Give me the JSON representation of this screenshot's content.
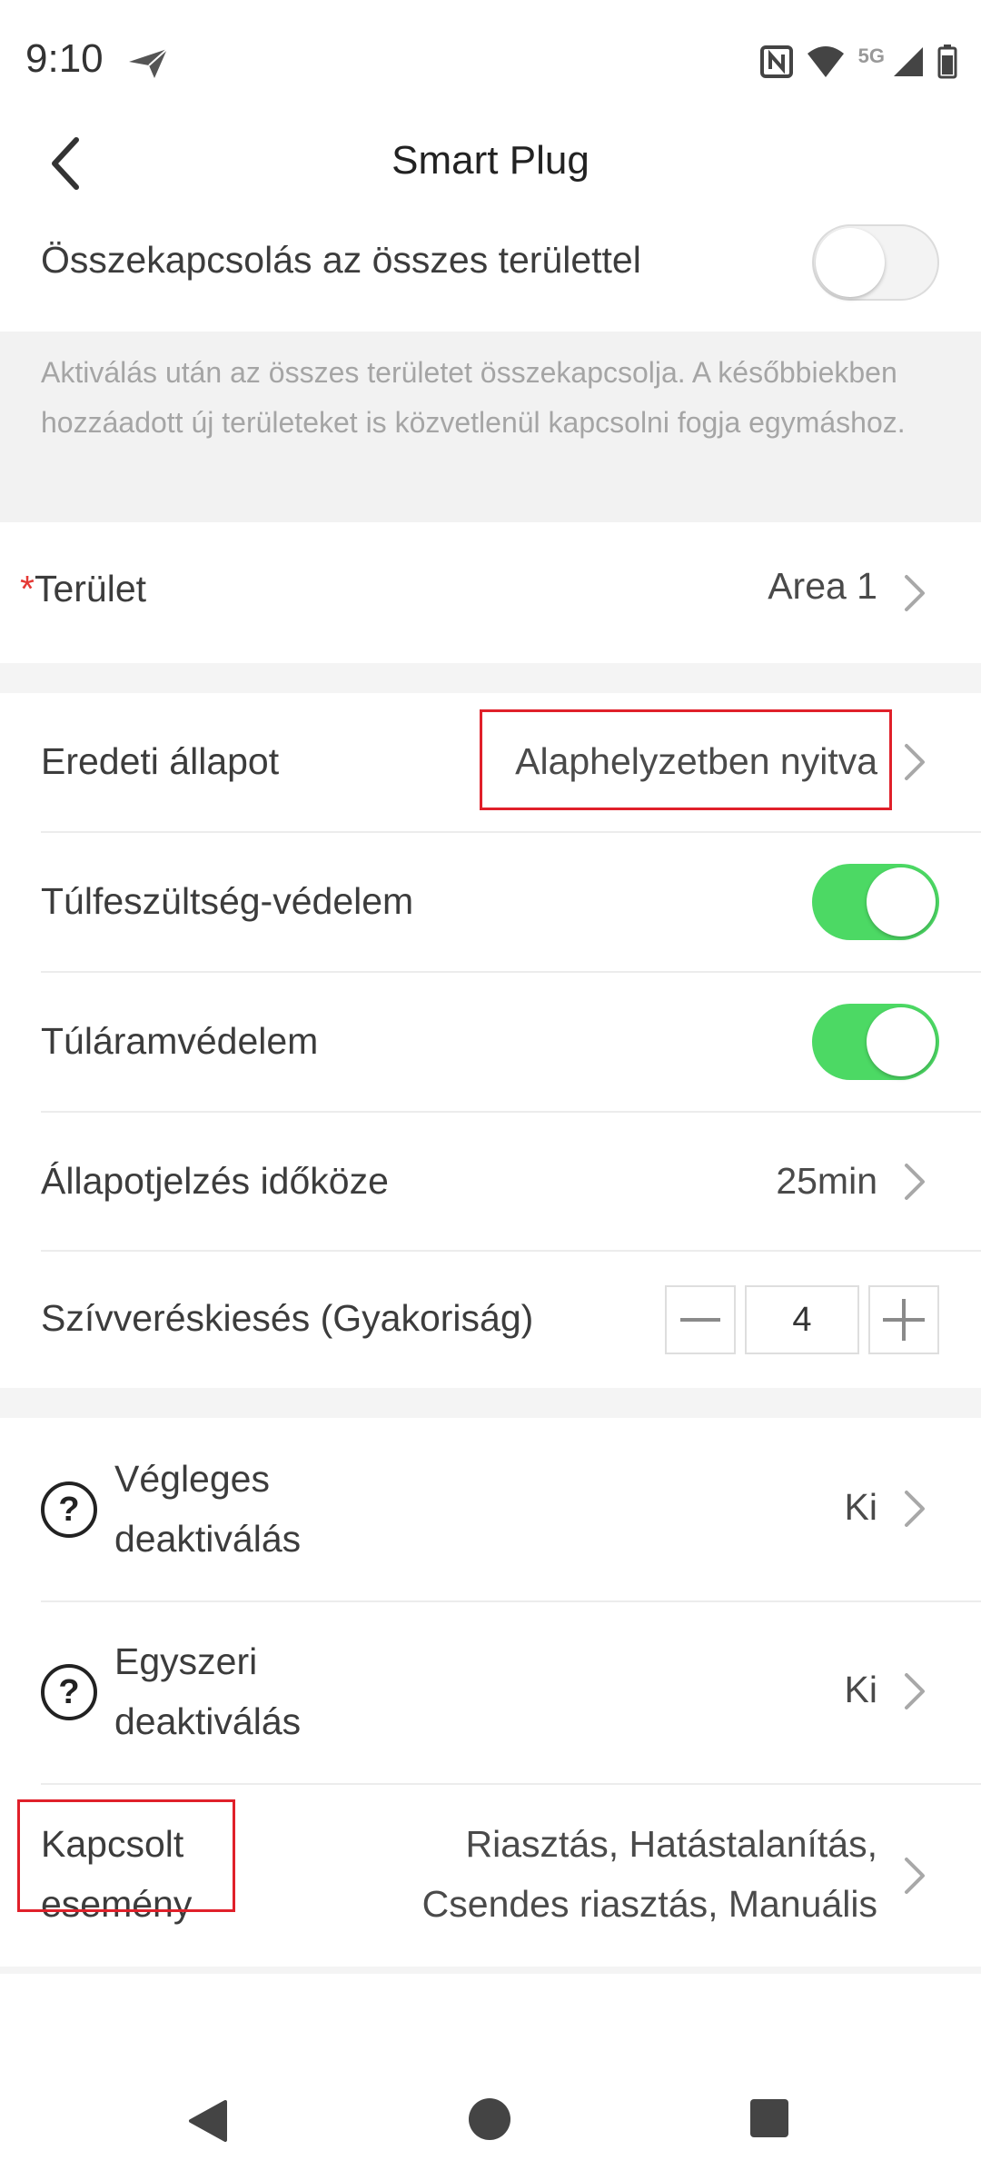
{
  "status_bar": {
    "time": "9:10",
    "network": "5G"
  },
  "header": {
    "title": "Smart Plug"
  },
  "link_all": {
    "label": "Összekapcsolás az összes területtel",
    "enabled": false,
    "info": "Aktiválás után az összes területet összekapcsolja. A későbbiekben hozzáadott új területeket is közvetlenül kapcsolni fogja egymáshoz."
  },
  "area": {
    "required_mark": "*",
    "label": "Terület",
    "value": "Area 1"
  },
  "settings": {
    "initial_state": {
      "label": "Eredeti állapot",
      "value": "Alaphelyzetben nyitva"
    },
    "overvoltage": {
      "label": "Túlfeszültség-védelem",
      "enabled": true
    },
    "overcurrent": {
      "label": "Túláramvédelem",
      "enabled": true
    },
    "status_interval": {
      "label": "Állapotjelzés időköze",
      "value": "25min"
    },
    "heartbeat": {
      "label": "Szívveréskiesés (Gyakoriság)",
      "value": "4"
    }
  },
  "deactivation": {
    "permanent": {
      "label_line1": "Végleges",
      "label_line2": "deaktiválás",
      "value": "Ki"
    },
    "one_time": {
      "label_line1": "Egyszeri",
      "label_line2": "deaktiválás",
      "value": "Ki"
    },
    "linked_event": {
      "label_line1": "Kapcsolt",
      "label_line2": "esemény",
      "value_line1": "Riasztás, Hatástalanítás,",
      "value_line2": "Csendes riasztás, Manuális"
    }
  },
  "colors": {
    "toggle_on": "#4cd964",
    "required": "#e53935",
    "highlight": "#e0202a"
  }
}
